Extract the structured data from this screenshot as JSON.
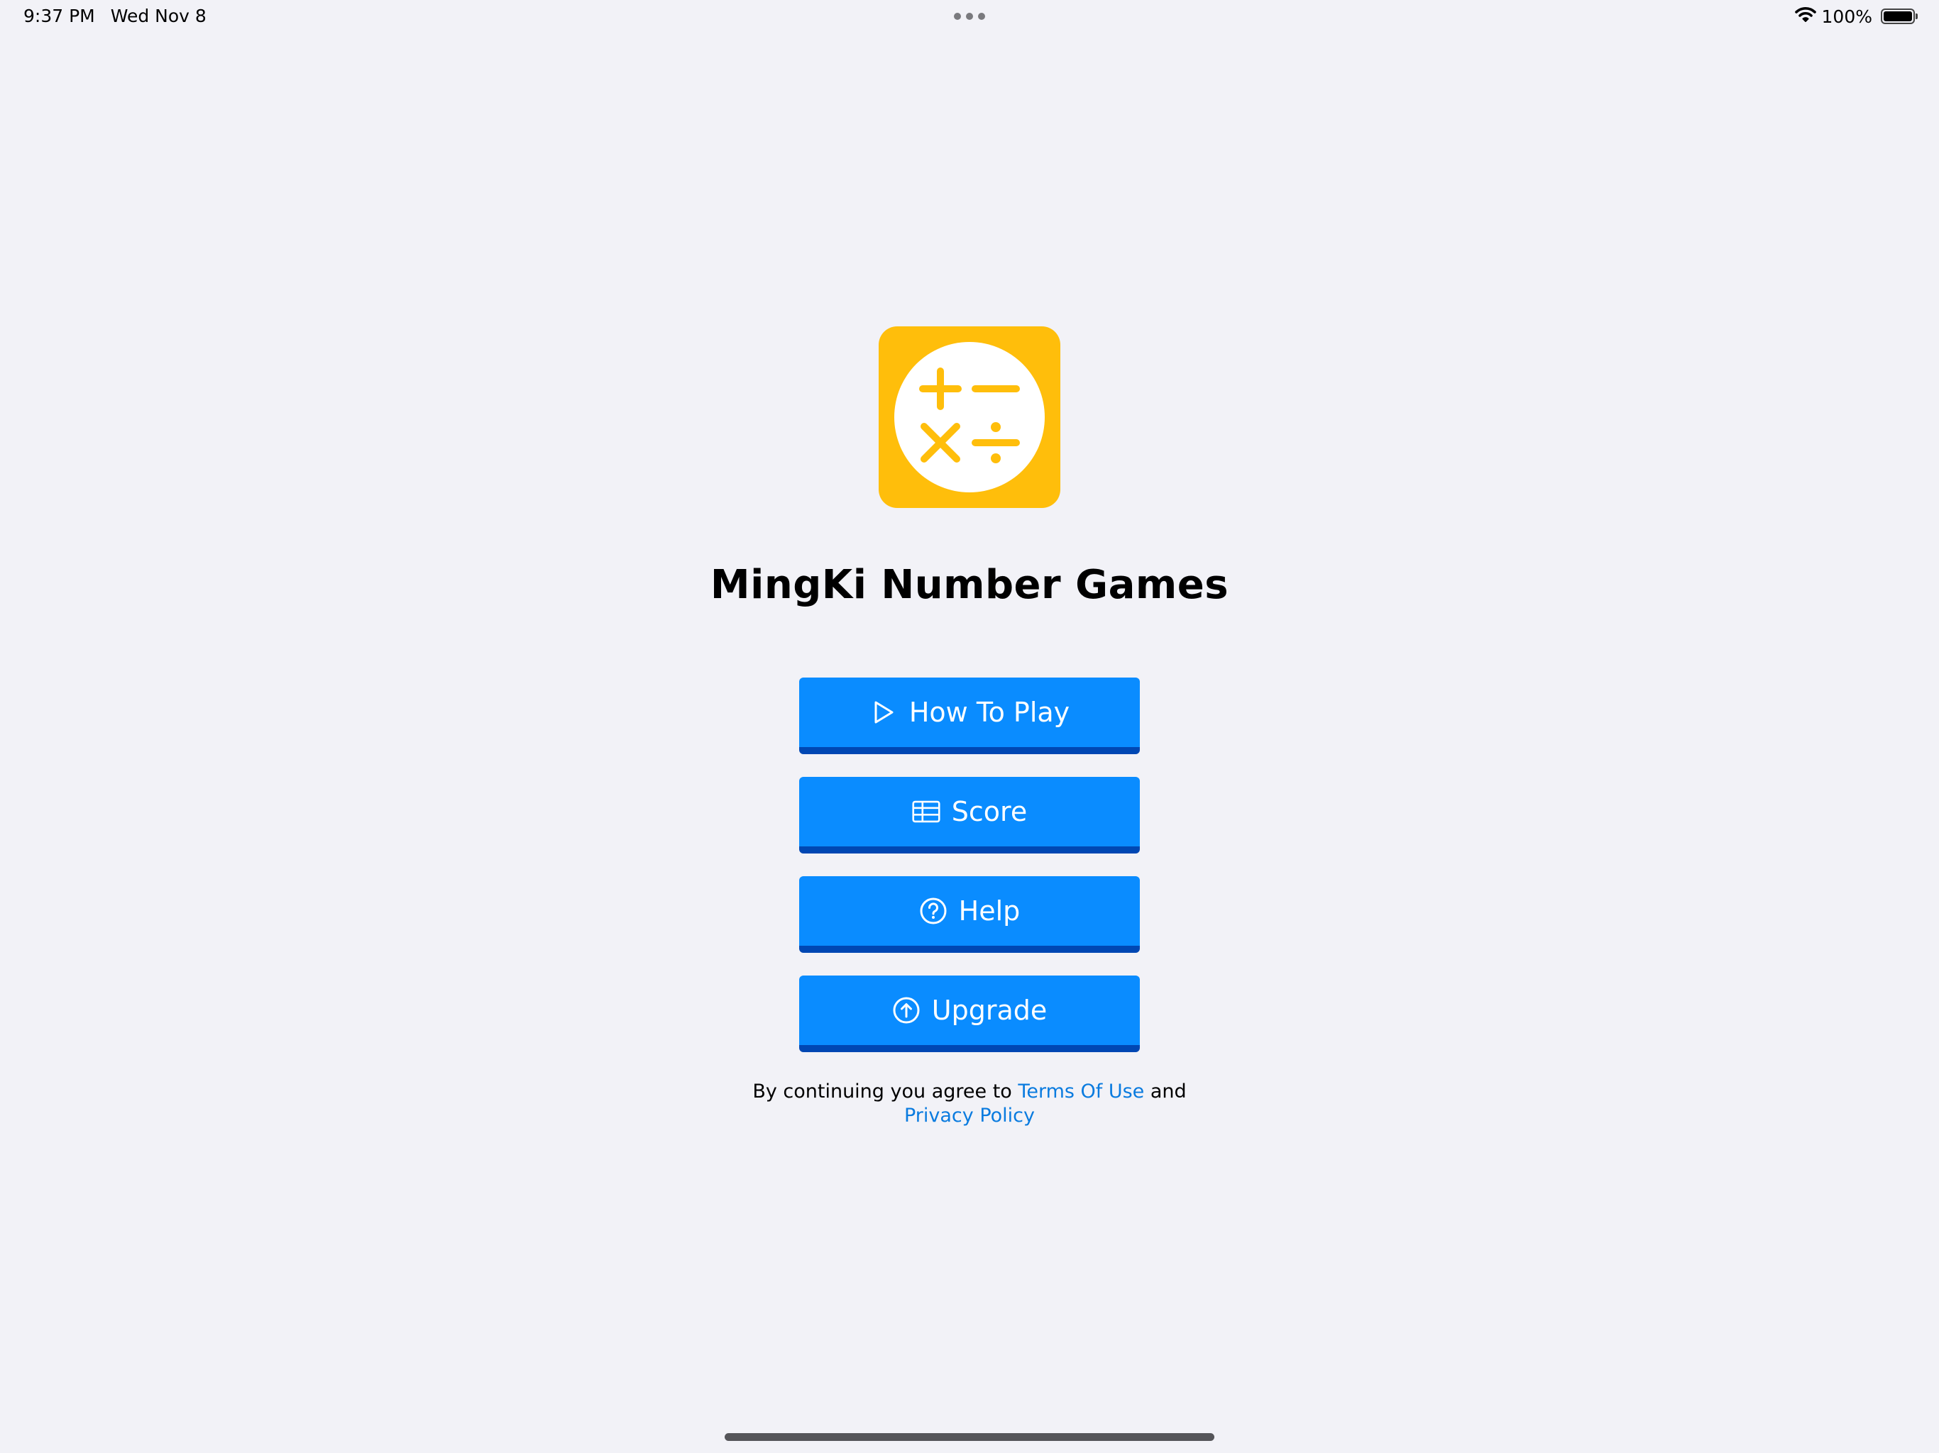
{
  "status_bar": {
    "time": "9:37 PM",
    "date": "Wed Nov 8",
    "battery_percent": "100%",
    "battery_level": 1.0,
    "wifi_icon": "wifi-icon",
    "battery_icon": "battery-icon"
  },
  "app": {
    "icon": "math-operators-icon",
    "icon_colors": {
      "background": "#ffbe0b",
      "circle": "#ffffff",
      "symbols": "#ffbe0b"
    },
    "title": "MingKi Number Games"
  },
  "menu": {
    "buttons": [
      {
        "label": "How To Play",
        "icon": "play-icon"
      },
      {
        "label": "Score",
        "icon": "table-icon"
      },
      {
        "label": "Help",
        "icon": "question-circle-icon"
      },
      {
        "label": "Upgrade",
        "icon": "arrow-up-circle-icon"
      }
    ],
    "colors": {
      "button": "#0a8cff",
      "button_shadow": "#0047b3",
      "label": "#ffffff"
    }
  },
  "legal": {
    "prefix": "By continuing you agree to",
    "terms_link": "Terms Of Use",
    "conjunction": "and",
    "privacy_link": "Privacy Policy",
    "link_color": "#0a7bdf"
  }
}
